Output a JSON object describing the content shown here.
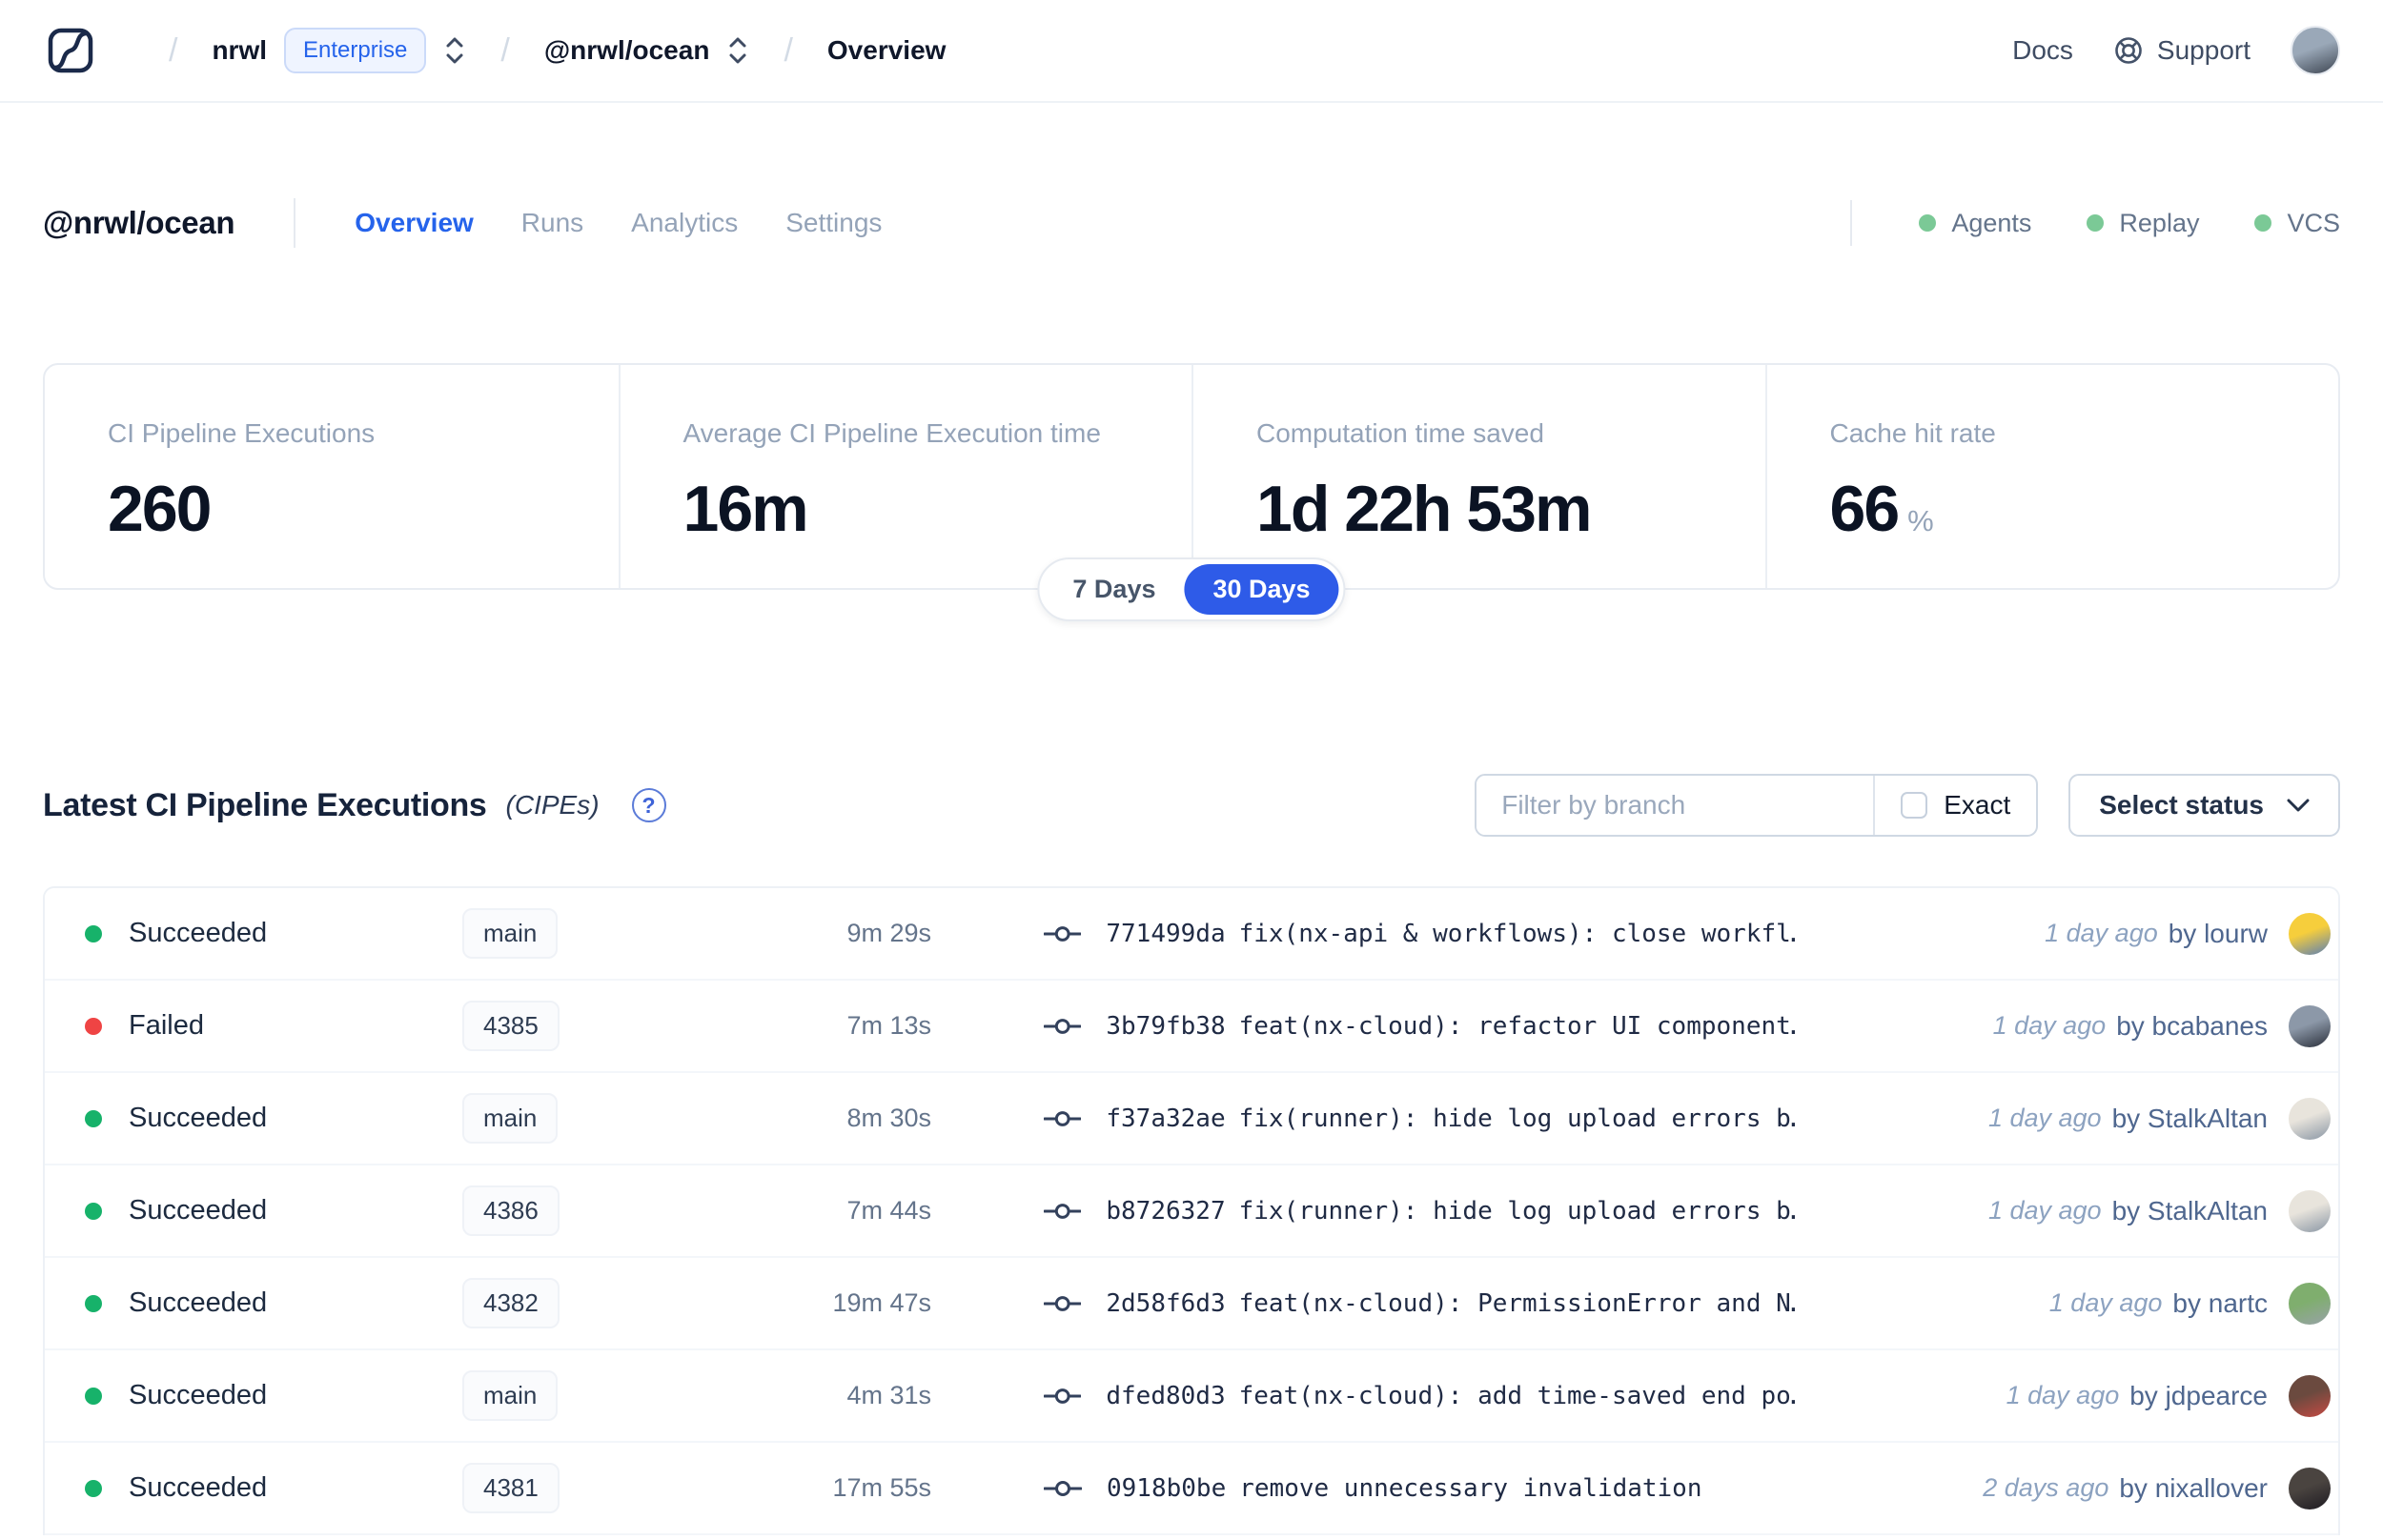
{
  "navbar": {
    "separator": "/",
    "breadcrumb": {
      "org": "nrwl",
      "org_badge": "Enterprise",
      "workspace": "@nrwl/ocean",
      "page": "Overview"
    },
    "links": {
      "docs": "Docs",
      "support": "Support"
    },
    "avatar_colors": [
      "#9AA8B8",
      "#3E4652"
    ]
  },
  "workspace_header": {
    "title": "@nrwl/ocean",
    "tabs": [
      {
        "label": "Overview",
        "active": true
      },
      {
        "label": "Runs",
        "active": false
      },
      {
        "label": "Analytics",
        "active": false
      },
      {
        "label": "Settings",
        "active": false
      }
    ],
    "status_indicators": [
      {
        "label": "Agents",
        "dot_color": "#7BC996"
      },
      {
        "label": "Replay",
        "dot_color": "#7BC996"
      },
      {
        "label": "VCS",
        "dot_color": "#7BC996"
      }
    ]
  },
  "stats": {
    "cards": [
      {
        "label": "CI Pipeline Executions",
        "value": "260",
        "unit": ""
      },
      {
        "label": "Average CI Pipeline Execution time",
        "value": "16m",
        "unit": ""
      },
      {
        "label": "Computation time saved",
        "value": "1d 22h 53m",
        "unit": ""
      },
      {
        "label": "Cache hit rate",
        "value": "66",
        "unit": "%"
      }
    ],
    "range_toggle": {
      "options": [
        "7 Days",
        "30 Days"
      ],
      "selected": "30 Days"
    }
  },
  "cipe_section": {
    "title": "Latest CI Pipeline Executions",
    "title_suffix": "(CIPEs)",
    "help_glyph": "?",
    "filter": {
      "branch_placeholder": "Filter by branch",
      "exact_label": "Exact",
      "status_label": "Select status"
    },
    "rows": [
      {
        "status": "Succeeded",
        "status_color": "#17B26A",
        "branch": "main",
        "duration": "9m 29s",
        "commit_hash": "771499da",
        "commit_message": "fix(nx-api & workflows): close workfl…",
        "time_ago": "1 day ago",
        "author": "by lourw",
        "avatar_colors": [
          "#F6CE3C",
          "#5B7FB5"
        ]
      },
      {
        "status": "Failed",
        "status_color": "#EF4444",
        "branch": "4385",
        "duration": "7m 13s",
        "commit_hash": "3b79fb38",
        "commit_message": "feat(nx-cloud): refactor UI component…",
        "time_ago": "1 day ago",
        "author": "by bcabanes",
        "avatar_colors": [
          "#8C98A8",
          "#2A2F3A"
        ]
      },
      {
        "status": "Succeeded",
        "status_color": "#17B26A",
        "branch": "main",
        "duration": "8m 30s",
        "commit_hash": "f37a32ae",
        "commit_message": "fix(runner): hide log upload errors b…",
        "time_ago": "1 day ago",
        "author": "by StalkAltan",
        "avatar_colors": [
          "#E8E4DC",
          "#8A96A4"
        ]
      },
      {
        "status": "Succeeded",
        "status_color": "#17B26A",
        "branch": "4386",
        "duration": "7m 44s",
        "commit_hash": "b8726327",
        "commit_message": "fix(runner): hide log upload errors b…",
        "time_ago": "1 day ago",
        "author": "by StalkAltan",
        "avatar_colors": [
          "#E8E4DC",
          "#8A96A4"
        ]
      },
      {
        "status": "Succeeded",
        "status_color": "#17B26A",
        "branch": "4382",
        "duration": "19m 47s",
        "commit_hash": "2d58f6d3",
        "commit_message": "feat(nx-cloud): PermissionError and N…",
        "time_ago": "1 day ago",
        "author": "by nartc",
        "avatar_colors": [
          "#7FAE6E",
          "#98A2A8"
        ]
      },
      {
        "status": "Succeeded",
        "status_color": "#17B26A",
        "branch": "main",
        "duration": "4m 31s",
        "commit_hash": "dfed80d3",
        "commit_message": "feat(nx-cloud): add time-saved end po…",
        "time_ago": "1 day ago",
        "author": "by jdpearce",
        "avatar_colors": [
          "#6B4A3F",
          "#C64A43"
        ]
      },
      {
        "status": "Succeeded",
        "status_color": "#17B26A",
        "branch": "4381",
        "duration": "17m 55s",
        "commit_hash": "0918b0be",
        "commit_message": "remove unnecessary invalidation",
        "time_ago": "2 days ago",
        "author": "by nixallover",
        "avatar_colors": [
          "#4A4440",
          "#1E1B22"
        ]
      }
    ]
  },
  "colors": {
    "accent": "#2E5BE8",
    "tab_active": "#2563EB",
    "success": "#17B26A",
    "fail": "#EF4444"
  }
}
